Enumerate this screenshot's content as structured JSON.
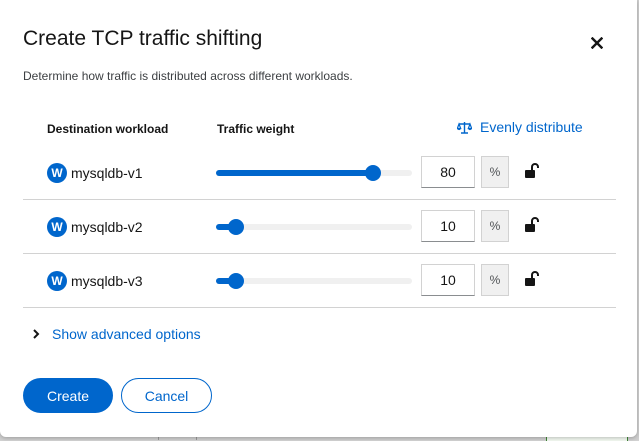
{
  "modal": {
    "title": "Create TCP traffic shifting",
    "description": "Determine how traffic is distributed across different workloads.",
    "close_icon": "close-icon"
  },
  "table": {
    "headers": {
      "destination": "Destination workload",
      "weight": "Traffic weight"
    },
    "evenly_distribute": {
      "label": "Evenly distribute",
      "icon": "balance-scale-icon"
    },
    "rows": [
      {
        "badge": "W",
        "name": "mysqldb-v1",
        "weight": "80",
        "unit": "%",
        "slider_percent": 80,
        "lock_icon": "unlock-icon"
      },
      {
        "badge": "W",
        "name": "mysqldb-v2",
        "weight": "10",
        "unit": "%",
        "slider_percent": 10,
        "lock_icon": "unlock-icon"
      },
      {
        "badge": "W",
        "name": "mysqldb-v3",
        "weight": "10",
        "unit": "%",
        "slider_percent": 10,
        "lock_icon": "unlock-icon"
      }
    ]
  },
  "advanced": {
    "label": "Show advanced options",
    "icon": "chevron-right-icon"
  },
  "footer": {
    "create_label": "Create",
    "cancel_label": "Cancel"
  },
  "colors": {
    "accent": "#0066cc",
    "text": "#151515",
    "divider": "#d2d2d2"
  }
}
